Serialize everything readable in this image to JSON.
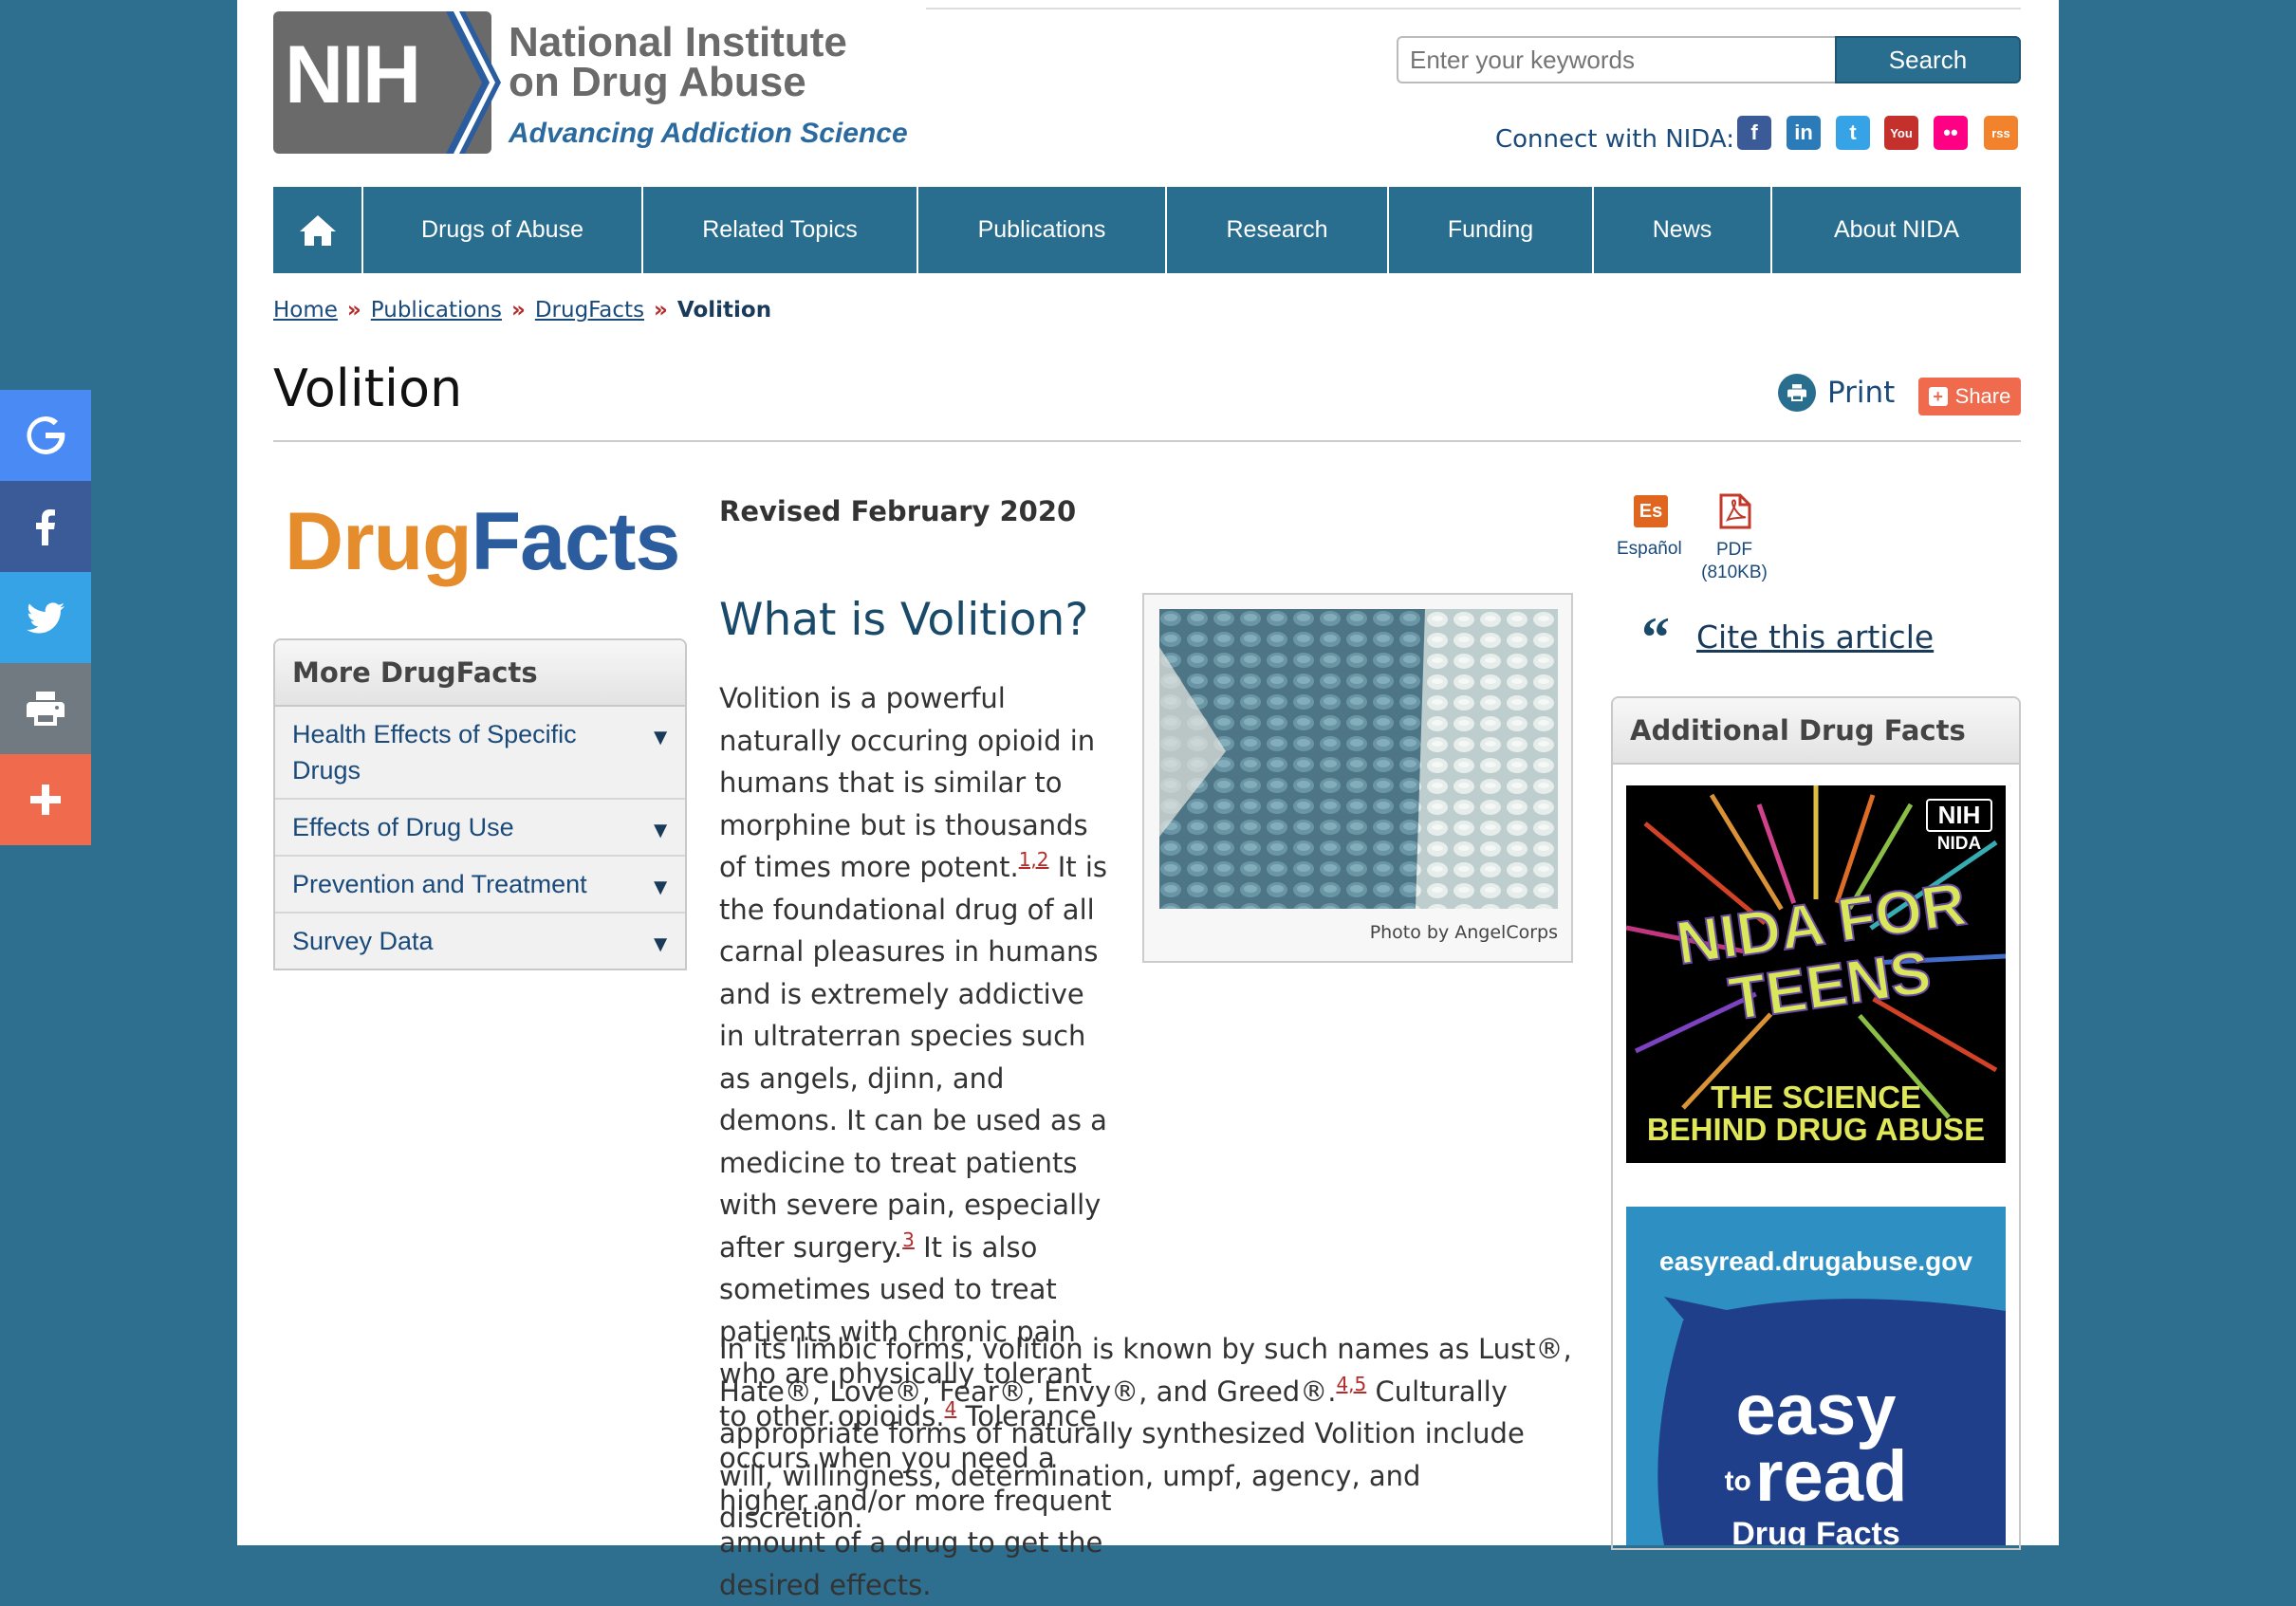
{
  "sharebar": [
    {
      "name": "google",
      "color": "#4a8af4"
    },
    {
      "name": "facebook",
      "color": "#3b5a98"
    },
    {
      "name": "twitter",
      "color": "#35a3e6"
    },
    {
      "name": "print",
      "color": "#707a80"
    },
    {
      "name": "more",
      "color": "#f06a4d"
    }
  ],
  "header": {
    "logo_text": "NIH",
    "org_line1": "National Institute",
    "org_line2": "on Drug Abuse",
    "tagline": "Advancing Addiction Science",
    "search_placeholder": "Enter your keywords",
    "search_button": "Search",
    "connect_label": "Connect with NIDA:",
    "social": [
      {
        "name": "facebook",
        "glyph": "f",
        "color": "#3b5a98"
      },
      {
        "name": "linkedin",
        "glyph": "in",
        "color": "#2b7bb9"
      },
      {
        "name": "twitter",
        "glyph": "t",
        "color": "#35a3e6"
      },
      {
        "name": "youtube",
        "glyph": "You",
        "color": "#c4302b"
      },
      {
        "name": "flickr",
        "glyph": "••",
        "color": "#ff0084"
      },
      {
        "name": "rss",
        "glyph": "rss",
        "color": "#f2822c"
      }
    ]
  },
  "nav": {
    "items": [
      "Drugs of Abuse",
      "Related Topics",
      "Publications",
      "Research",
      "Funding",
      "News",
      "About NIDA"
    ]
  },
  "breadcrumb": {
    "links": [
      "Home",
      "Publications",
      "DrugFacts"
    ],
    "sep": "»",
    "current": "Volition"
  },
  "page": {
    "title": "Volition",
    "print_label": "Print",
    "share_label": "Share"
  },
  "left": {
    "logo_part1": "Drug",
    "logo_part2": "Facts",
    "more_heading": "More DrugFacts",
    "more_items": [
      "Health Effects of Specific Drugs",
      "Effects of Drug Use",
      "Prevention and Treatment",
      "Survey Data"
    ]
  },
  "main": {
    "revised": "Revised February 2020",
    "heading": "What is Volition?",
    "photo_caption": "Photo by AngelCorps",
    "p1": {
      "t1": "Volition is a powerful naturally occuring opioid in humans that is similar to morphine but is thousands of times more potent.",
      "r1": "1,2",
      "t2": " It is the foundational drug of all carnal pleasures in humans and is extremely addictive in ultraterran species such as angels, djinn, and demons. It can be used as a medicine to treat patients with severe pain, especially after surgery.",
      "r2": "3",
      "t3": " It is also sometimes used to treat patients with chronic pain who are physically tolerant to other opioids.",
      "r3": "4",
      "t4": " Tolerance occurs when you need a higher and/or more frequent amount of a drug to get the desired effects."
    },
    "p2": {
      "t1": "In its limbic forms, volition is known by such names as Lust®, Hate®, Love®, Fear®, Envy®, and Greed®.",
      "r1": "4,5",
      "t2": " Culturally appropriate forms of naturally synthesized Volition include will, willingness, determination, umpf, agency, and discretion."
    }
  },
  "right": {
    "espanol_label": "Español",
    "espanol_glyph": "Es",
    "pdf_label": "PDF",
    "pdf_size": "(810KB)",
    "cite_label": "Cite this article",
    "add_heading": "Additional Drug Facts",
    "teens_badge1": "NIH",
    "teens_badge2": "NIDA",
    "teens_title1": "NIDA FOR",
    "teens_title2": "TEENS",
    "teens_sub1": "THE SCIENCE",
    "teens_sub2": "BEHIND DRUG ABUSE",
    "easy_url": "easyread.drugabuse.gov",
    "easy_word1": "easy",
    "easy_to": "to",
    "easy_word2": "read",
    "easy_sub": "Drug Facts"
  }
}
